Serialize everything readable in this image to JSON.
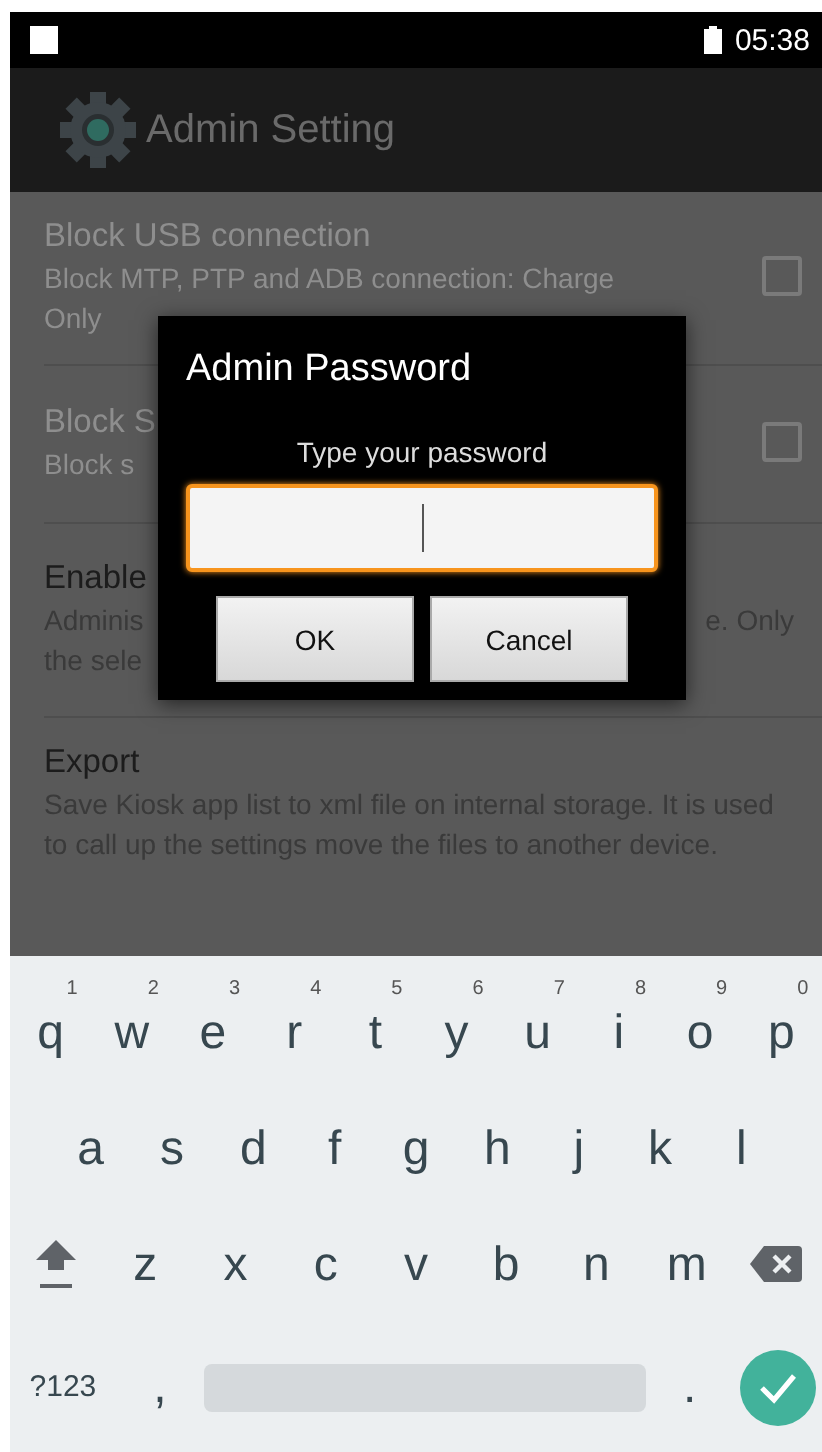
{
  "status_bar": {
    "time": "05:38"
  },
  "app_bar": {
    "title": "Admin Setting"
  },
  "settings": [
    {
      "kind": "checkbox",
      "checked": false,
      "title": "Block USB connection",
      "lines": [
        {
          "left": "Block MTP, PTP and ADB connection: Charge Only"
        }
      ]
    },
    {
      "kind": "checkbox",
      "checked": false,
      "title": "Block S",
      "lines": [
        {
          "left": "Block s"
        }
      ]
    },
    {
      "kind": "plain",
      "title": "Enable",
      "lines": [
        {
          "left": "Adminis",
          "right": "e. Only"
        },
        {
          "left": "the sele"
        }
      ]
    },
    {
      "kind": "plain",
      "title": "Export",
      "lines": [
        {
          "left": "Save Kiosk app list to xml file on internal storage. It is used to call up the settings move the files to another device."
        }
      ]
    }
  ],
  "dialog": {
    "title": "Admin Password",
    "message": "Type your password",
    "password_field": {
      "focused": true
    },
    "buttons": [
      "OK",
      "Cancel"
    ]
  },
  "keyboard": {
    "rows": [
      {
        "keys": [
          {
            "kind": "letter",
            "label": "q",
            "hint": "1"
          },
          {
            "kind": "letter",
            "label": "w",
            "hint": "2"
          },
          {
            "kind": "letter",
            "label": "e",
            "hint": "3"
          },
          {
            "kind": "letter",
            "label": "r",
            "hint": "4"
          },
          {
            "kind": "letter",
            "label": "t",
            "hint": "5"
          },
          {
            "kind": "letter",
            "label": "y",
            "hint": "6"
          },
          {
            "kind": "letter",
            "label": "u",
            "hint": "7"
          },
          {
            "kind": "letter",
            "label": "i",
            "hint": "8"
          },
          {
            "kind": "letter",
            "label": "o",
            "hint": "9"
          },
          {
            "kind": "letter",
            "label": "p",
            "hint": "0"
          }
        ]
      },
      {
        "keys": [
          {
            "kind": "letter",
            "label": "a"
          },
          {
            "kind": "letter",
            "label": "s"
          },
          {
            "kind": "letter",
            "label": "d"
          },
          {
            "kind": "letter",
            "label": "f"
          },
          {
            "kind": "letter",
            "label": "g"
          },
          {
            "kind": "letter",
            "label": "h"
          },
          {
            "kind": "letter",
            "label": "j"
          },
          {
            "kind": "letter",
            "label": "k"
          },
          {
            "kind": "letter",
            "label": "l"
          }
        ]
      },
      {
        "keys": [
          {
            "kind": "shift"
          },
          {
            "kind": "letter",
            "label": "z"
          },
          {
            "kind": "letter",
            "label": "x"
          },
          {
            "kind": "letter",
            "label": "c"
          },
          {
            "kind": "letter",
            "label": "v"
          },
          {
            "kind": "letter",
            "label": "b"
          },
          {
            "kind": "letter",
            "label": "n"
          },
          {
            "kind": "letter",
            "label": "m"
          },
          {
            "kind": "backspace"
          }
        ]
      },
      {
        "keys": [
          {
            "kind": "symbols",
            "label": "?123"
          },
          {
            "kind": "letter",
            "label": ","
          },
          {
            "kind": "space"
          },
          {
            "kind": "letter",
            "label": "."
          },
          {
            "kind": "enter"
          }
        ]
      }
    ]
  }
}
